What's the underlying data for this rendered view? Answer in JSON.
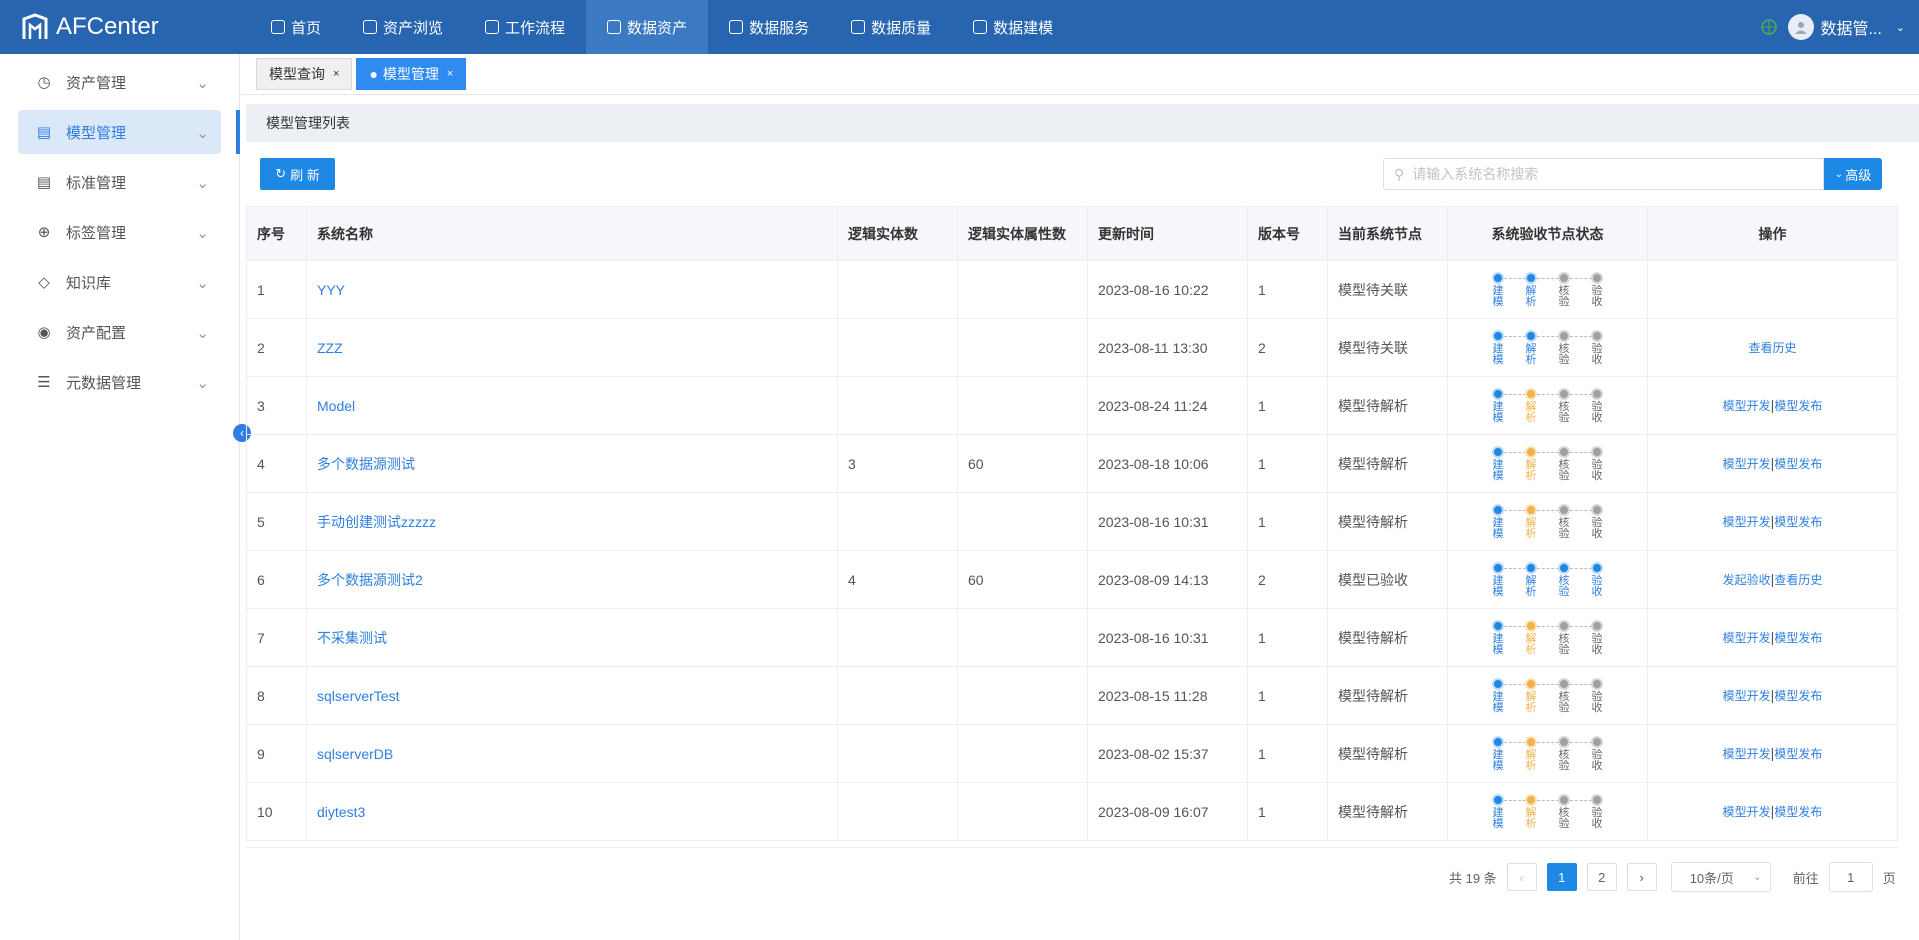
{
  "app": {
    "title": "AFCenter",
    "user": "数据管..."
  },
  "nav": {
    "items": [
      "首页",
      "资产浏览",
      "工作流程",
      "数据资产",
      "数据服务",
      "数据质量",
      "数据建模"
    ],
    "active_index": 3
  },
  "sidebar": {
    "items": [
      "资产管理",
      "模型管理",
      "标准管理",
      "标签管理",
      "知识库",
      "资产配置",
      "元数据管理"
    ],
    "active_index": 1
  },
  "tabs": [
    {
      "label": "模型查询"
    },
    {
      "label": "模型管理"
    }
  ],
  "panel": {
    "title": "模型管理列表"
  },
  "toolbar": {
    "refresh_label": "刷 新",
    "search_placeholder": "请输入系统名称搜索",
    "advanced_label": "高级"
  },
  "table": {
    "headers": [
      "序号",
      "系统名称",
      "逻辑实体数",
      "逻辑实体属性数",
      "更新时间",
      "版本号",
      "当前系统节点",
      "系统验收节点状态",
      "操作"
    ],
    "node_labels": [
      "建模",
      "解析",
      "核验",
      "验收"
    ],
    "rows": [
      {
        "no": "1",
        "name": "YYY",
        "entities": "",
        "attrs": "",
        "time": "2023-08-16 10:22",
        "version": "1",
        "node": "模型待关联",
        "states": [
          "blue",
          "blue",
          "gray",
          "gray"
        ],
        "ops": []
      },
      {
        "no": "2",
        "name": "ZZZ",
        "entities": "",
        "attrs": "",
        "time": "2023-08-11 13:30",
        "version": "2",
        "node": "模型待关联",
        "states": [
          "blue",
          "blue",
          "gray",
          "gray"
        ],
        "ops": [
          "查看历史"
        ]
      },
      {
        "no": "3",
        "name": "Model",
        "entities": "",
        "attrs": "",
        "time": "2023-08-24 11:24",
        "version": "1",
        "node": "模型待解析",
        "states": [
          "blue",
          "orange",
          "gray",
          "gray"
        ],
        "ops": [
          "模型开发",
          "模型发布"
        ]
      },
      {
        "no": "4",
        "name": "多个数据源测试",
        "entities": "3",
        "attrs": "60",
        "time": "2023-08-18 10:06",
        "version": "1",
        "node": "模型待解析",
        "states": [
          "blue",
          "orange",
          "gray",
          "gray"
        ],
        "ops": [
          "模型开发",
          "模型发布"
        ]
      },
      {
        "no": "5",
        "name": "手动创建测试zzzzz",
        "entities": "",
        "attrs": "",
        "time": "2023-08-16 10:31",
        "version": "1",
        "node": "模型待解析",
        "states": [
          "blue",
          "orange",
          "gray",
          "gray"
        ],
        "ops": [
          "模型开发",
          "模型发布"
        ]
      },
      {
        "no": "6",
        "name": "多个数据源测试2",
        "entities": "4",
        "attrs": "60",
        "time": "2023-08-09 14:13",
        "version": "2",
        "node": "模型已验收",
        "states": [
          "blue",
          "blue",
          "blue",
          "blue"
        ],
        "ops": [
          "发起验收",
          "查看历史"
        ]
      },
      {
        "no": "7",
        "name": "不采集测试",
        "entities": "",
        "attrs": "",
        "time": "2023-08-16 10:31",
        "version": "1",
        "node": "模型待解析",
        "states": [
          "blue",
          "orange",
          "gray",
          "gray"
        ],
        "ops": [
          "模型开发",
          "模型发布"
        ]
      },
      {
        "no": "8",
        "name": "sqlserverTest",
        "entities": "",
        "attrs": "",
        "time": "2023-08-15 11:28",
        "version": "1",
        "node": "模型待解析",
        "states": [
          "blue",
          "orange",
          "gray",
          "gray"
        ],
        "ops": [
          "模型开发",
          "模型发布"
        ]
      },
      {
        "no": "9",
        "name": "sqlserverDB",
        "entities": "",
        "attrs": "",
        "time": "2023-08-02 15:37",
        "version": "1",
        "node": "模型待解析",
        "states": [
          "blue",
          "orange",
          "gray",
          "gray"
        ],
        "ops": [
          "模型开发",
          "模型发布"
        ]
      },
      {
        "no": "10",
        "name": "diytest3",
        "entities": "",
        "attrs": "",
        "time": "2023-08-09 16:07",
        "version": "1",
        "node": "模型待解析",
        "states": [
          "blue",
          "orange",
          "gray",
          "gray"
        ],
        "ops": [
          "模型开发",
          "模型发布"
        ]
      }
    ]
  },
  "pagination": {
    "total_label": "共 19 条",
    "pages": [
      "1",
      "2"
    ],
    "current": "1",
    "page_size": "10条/页",
    "goto_prefix": "前往",
    "goto_value": "1",
    "goto_suffix": "页"
  },
  "colors": {
    "primary": "#1e88e5",
    "topbar": "#2765b0",
    "warning": "#f0b24a"
  }
}
